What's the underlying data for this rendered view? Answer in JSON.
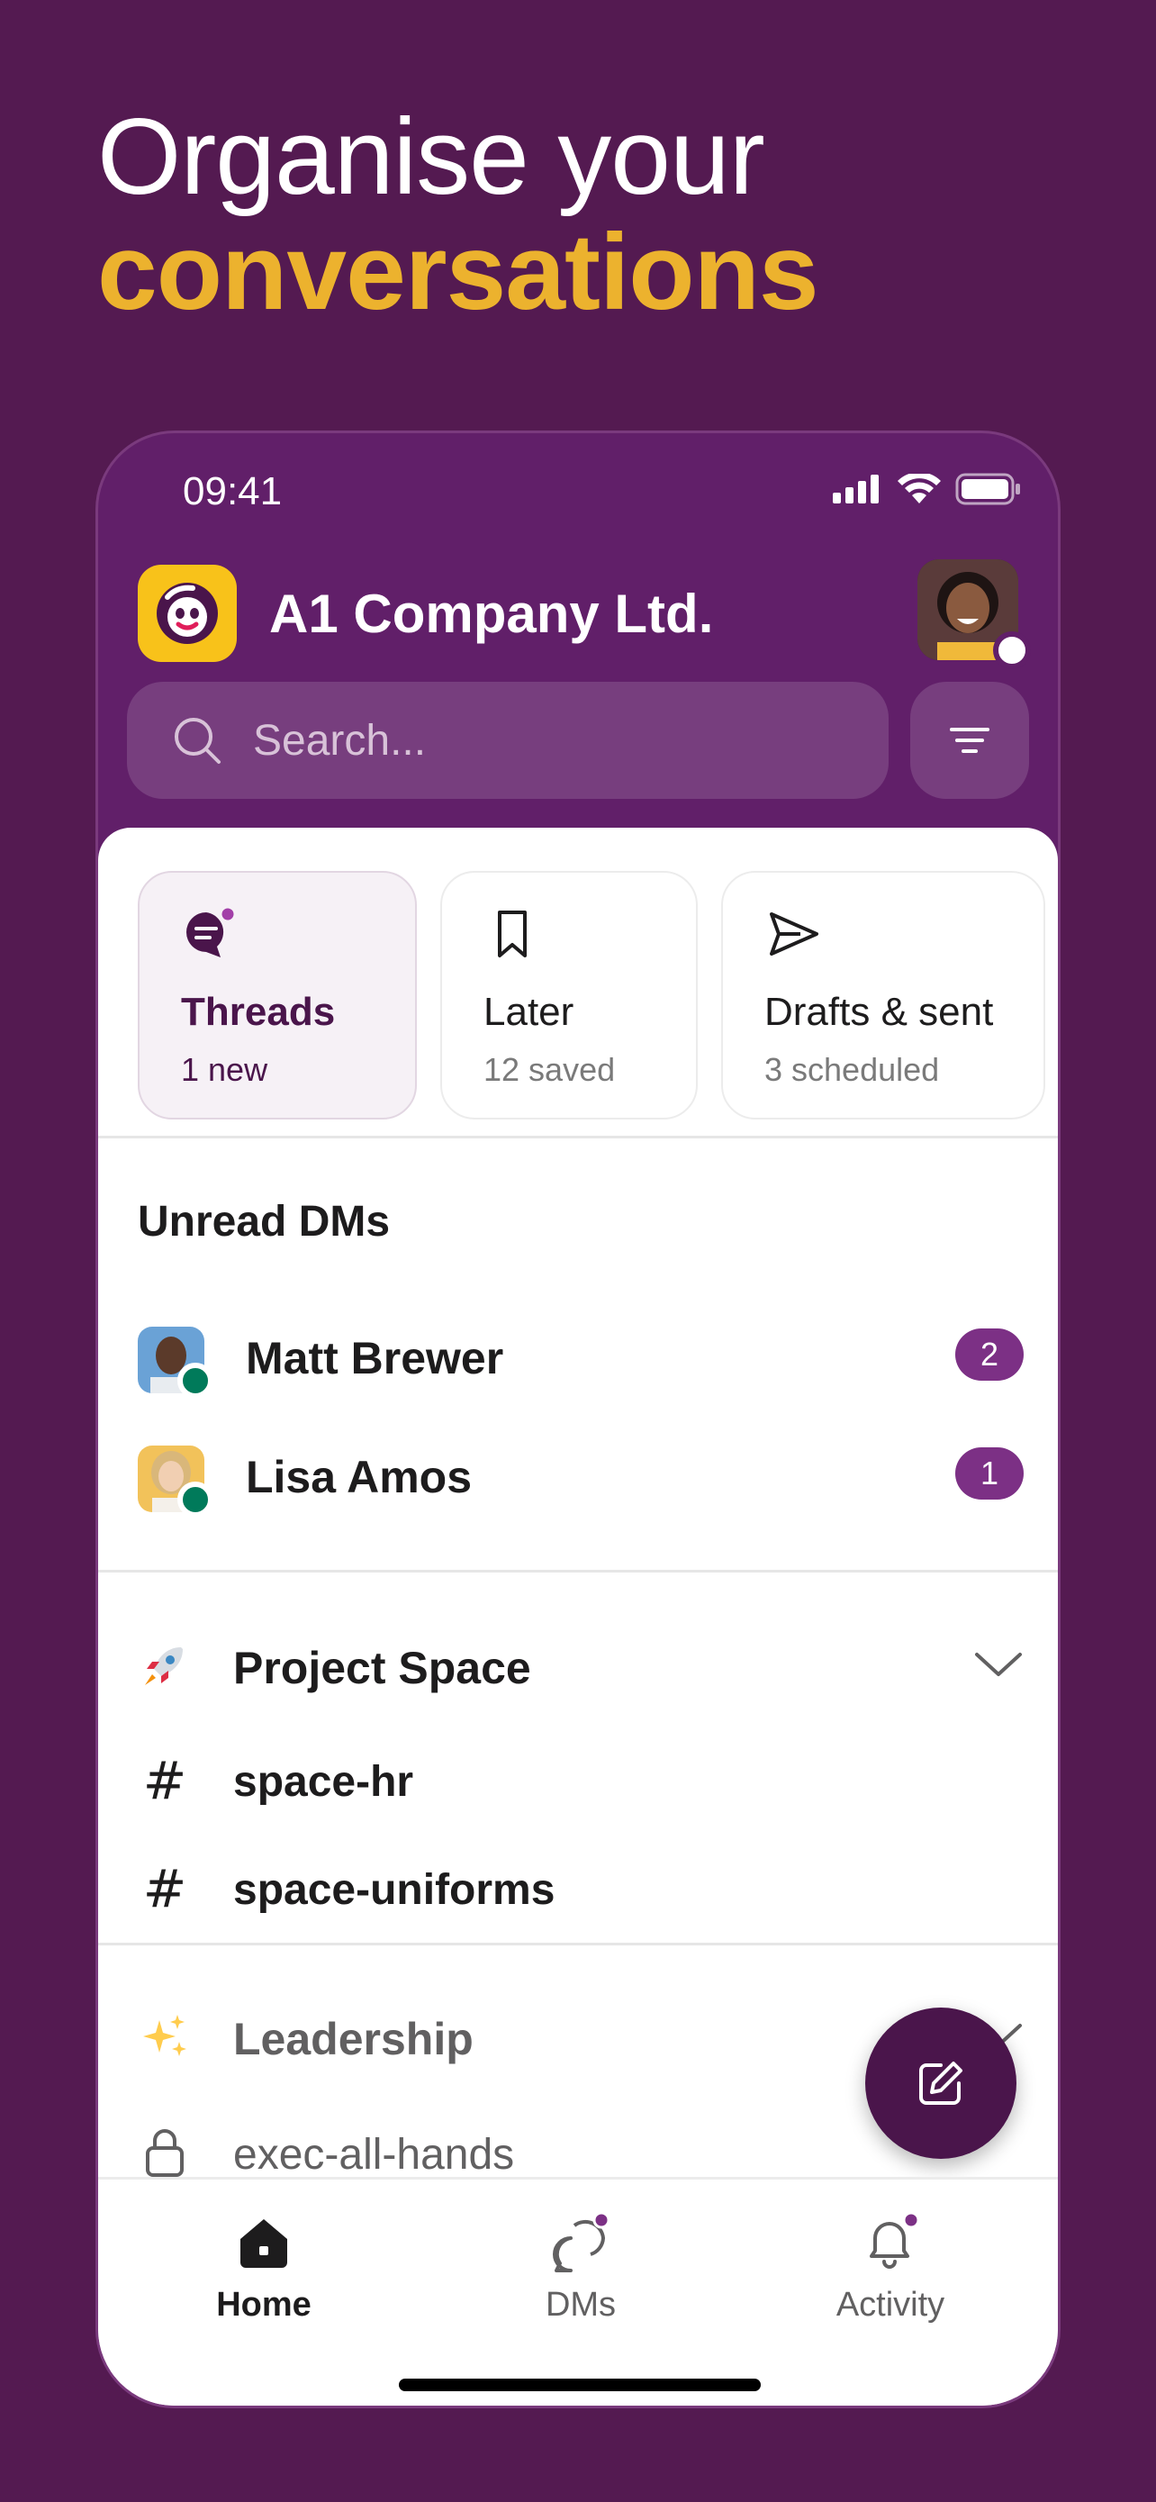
{
  "headline": {
    "line1": "Organise your",
    "line2": "conversations"
  },
  "status_bar": {
    "time": "09:41"
  },
  "header": {
    "company_name": "A1 Company Ltd.",
    "search_placeholder": "Search..."
  },
  "quick_cards": [
    {
      "title": "Threads",
      "subtitle": "1 new",
      "icon": "threads-icon"
    },
    {
      "title": "Later",
      "subtitle": "12 saved",
      "icon": "bookmark-icon"
    },
    {
      "title": "Drafts & sent",
      "subtitle": "3 scheduled",
      "icon": "send-icon"
    }
  ],
  "unread_dms": {
    "title": "Unread DMs",
    "items": [
      {
        "name": "Matt Brewer",
        "count": "2"
      },
      {
        "name": "Lisa Amos",
        "count": "1"
      }
    ]
  },
  "sections": [
    {
      "name": "Project Space",
      "icon": "rocket-icon",
      "channels": [
        {
          "name": "space-hr",
          "icon": "hash-icon"
        },
        {
          "name": "space-uniforms",
          "icon": "hash-icon"
        }
      ]
    },
    {
      "name": "Leadership",
      "icon": "sparkles-icon",
      "channels": [
        {
          "name": "exec-all-hands",
          "icon": "lock-icon"
        }
      ]
    }
  ],
  "tabs": [
    {
      "label": "Home",
      "icon": "home-icon",
      "active": true
    },
    {
      "label": "DMs",
      "icon": "dms-icon",
      "active": false
    },
    {
      "label": "Activity",
      "icon": "bell-icon",
      "active": false
    }
  ],
  "colors": {
    "background": "#541a51",
    "phone_header": "#611f69",
    "accent_yellow": "#ecb22e",
    "badge": "#7c3085",
    "fab": "#4a154b",
    "presence_online": "#007a5a"
  }
}
